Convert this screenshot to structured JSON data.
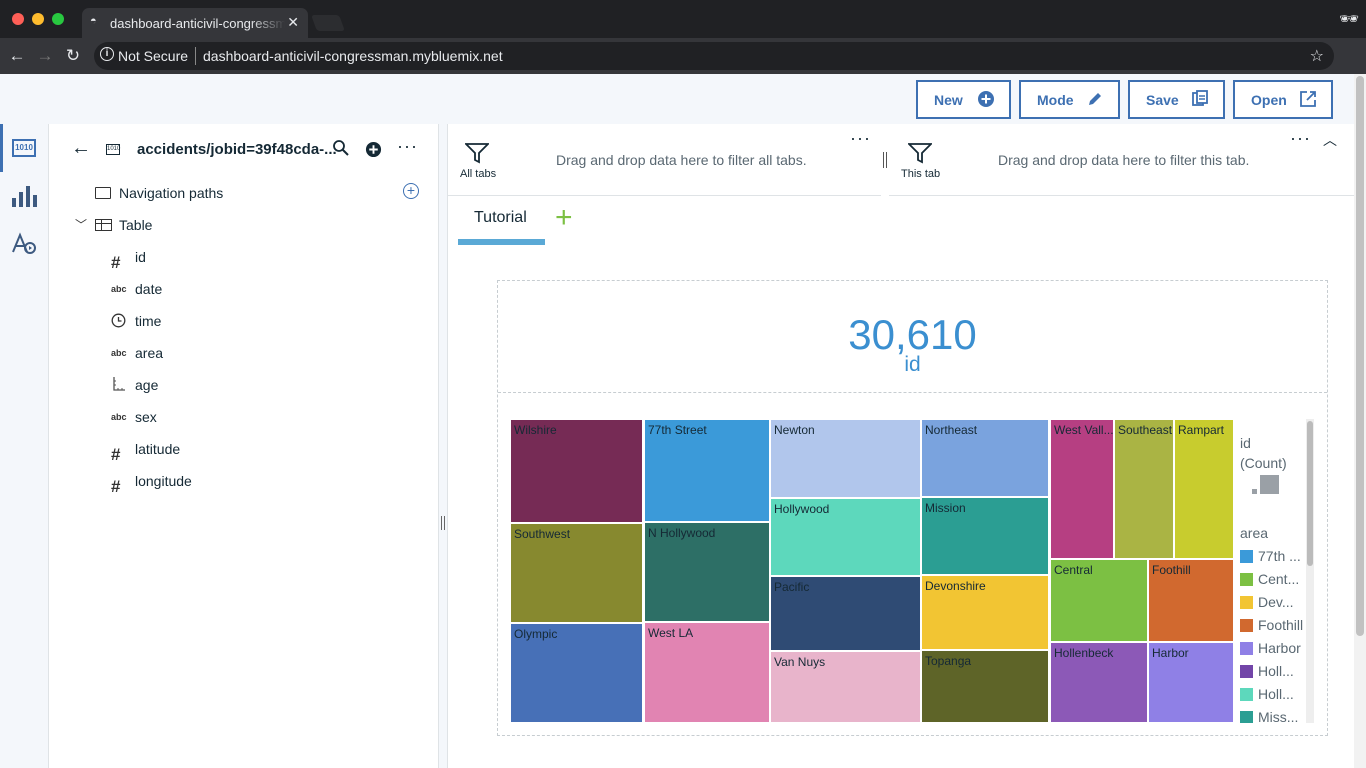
{
  "browser": {
    "tab_title": "dashboard-anticivil-congressman.mybluemix.net",
    "not_secure": "Not Secure",
    "url": "dashboard-anticivil-congressman.mybluemix.net"
  },
  "toolbar": {
    "new": "New",
    "mode": "Mode",
    "save": "Save",
    "open": "Open"
  },
  "datasource": {
    "title": "accidents/jobid=39f48cda-...",
    "nav_paths": "Navigation paths",
    "table": "Table",
    "fields": [
      {
        "name": "id",
        "type": "#"
      },
      {
        "name": "date",
        "type": "abc"
      },
      {
        "name": "time",
        "type": "clock"
      },
      {
        "name": "area",
        "type": "abc"
      },
      {
        "name": "age",
        "type": "ruler"
      },
      {
        "name": "sex",
        "type": "abc"
      },
      {
        "name": "latitude",
        "type": "#"
      },
      {
        "name": "longitude",
        "type": "#"
      }
    ]
  },
  "filters": {
    "all_label": "All tabs",
    "all_hint": "Drag and drop data here to filter all tabs.",
    "this_label": "This tab",
    "this_hint": "Drag and drop data here to filter this tab."
  },
  "tabs": {
    "active": "Tutorial"
  },
  "kpi": {
    "value": "30,610",
    "label": "id"
  },
  "legend": {
    "size_title": "id\n(Count)",
    "color_title": "area",
    "items": [
      {
        "label": "77th ...",
        "color": "#3b9ad9"
      },
      {
        "label": "Cent...",
        "color": "#7cc043"
      },
      {
        "label": "Dev...",
        "color": "#f2c533"
      },
      {
        "label": "Foothill",
        "color": "#d1692f"
      },
      {
        "label": "Harbor",
        "color": "#8f80e6"
      },
      {
        "label": "Holl...",
        "color": "#7245a8"
      },
      {
        "label": "Holl...",
        "color": "#5dd8bc"
      },
      {
        "label": "Miss...",
        "color": "#2b9e93"
      }
    ]
  },
  "chart_data": {
    "type": "treemap",
    "size_measure": "id (Count)",
    "color_by": "area",
    "cells": [
      {
        "label": "Wilshire",
        "color": "#762b55"
      },
      {
        "label": "77th Street",
        "color": "#3b9ad9"
      },
      {
        "label": "Newton",
        "color": "#b1c6ec"
      },
      {
        "label": "Northeast",
        "color": "#7aa3de"
      },
      {
        "label": "West Vall...",
        "color": "#b63f82"
      },
      {
        "label": "Southeast",
        "color": "#aab444"
      },
      {
        "label": "Rampart",
        "color": "#c8cc2e"
      },
      {
        "label": "Southwest",
        "color": "#87892f"
      },
      {
        "label": "N Hollywood",
        "color": "#2d6f66"
      },
      {
        "label": "Hollywood",
        "color": "#5dd8bc"
      },
      {
        "label": "Mission",
        "color": "#2b9e93"
      },
      {
        "label": "Central",
        "color": "#7cc043"
      },
      {
        "label": "Foothill",
        "color": "#d1692f"
      },
      {
        "label": "Pacific",
        "color": "#2f4b74"
      },
      {
        "label": "Devonshire",
        "color": "#f2c533"
      },
      {
        "label": "Olympic",
        "color": "#4770b7"
      },
      {
        "label": "West LA",
        "color": "#e184b2"
      },
      {
        "label": "Van Nuys",
        "color": "#e8b4cb"
      },
      {
        "label": "Topanga",
        "color": "#5e6428"
      },
      {
        "label": "Hollenbeck",
        "color": "#8c59b7"
      },
      {
        "label": "Harbor",
        "color": "#8f80e6"
      }
    ]
  }
}
